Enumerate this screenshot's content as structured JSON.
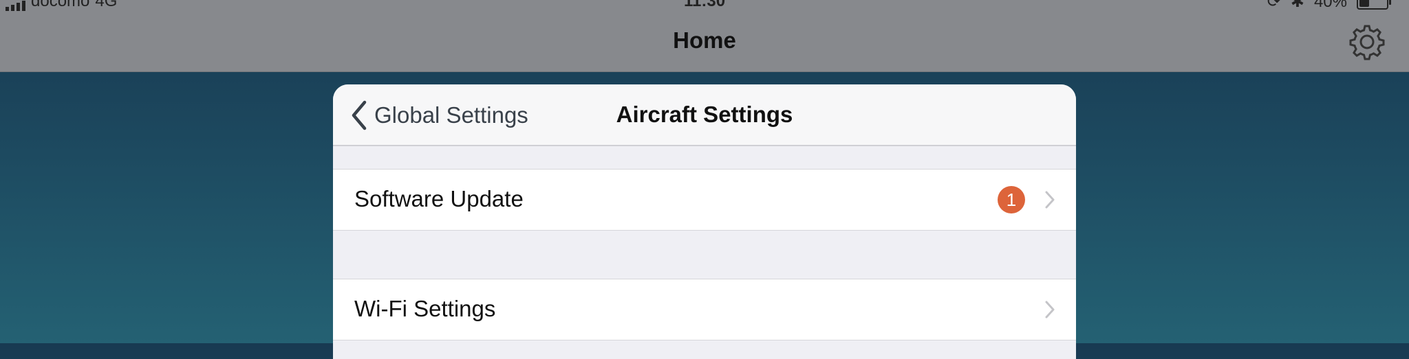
{
  "status_bar": {
    "carrier": "docomo",
    "network": "4G",
    "time": "11:30",
    "battery": "40%",
    "battery_level": 0.4
  },
  "nav_bar": {
    "title": "Home",
    "settings_icon": "gear-icon"
  },
  "panel": {
    "back_label": "Global Settings",
    "title": "Aircraft Settings",
    "rows": [
      {
        "label": "Software Update",
        "badge": "1"
      },
      {
        "label": "Wi-Fi Settings"
      }
    ]
  },
  "colors": {
    "badge": "#dd643a",
    "nav_bar": "#87898d",
    "background": "#1d4a60"
  }
}
